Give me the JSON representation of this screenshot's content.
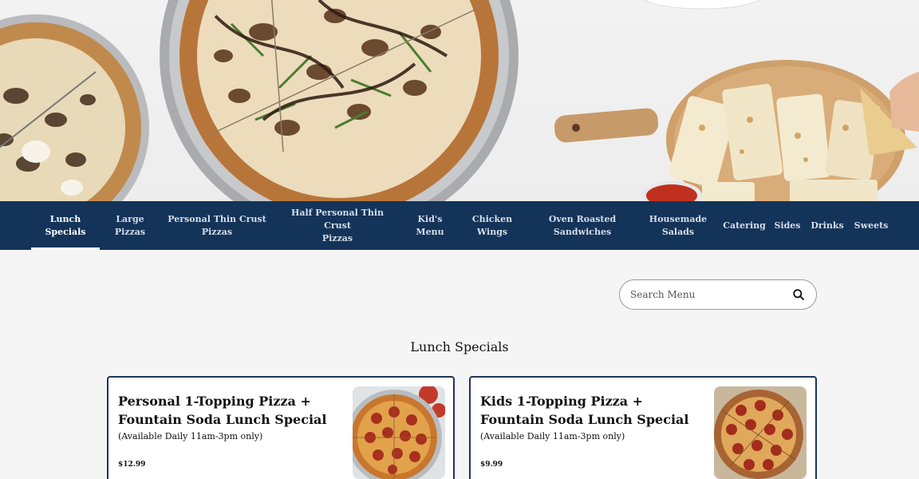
{
  "nav": {
    "items": [
      {
        "line1": "Lunch",
        "line2": "Specials",
        "active": true
      },
      {
        "line1": "Large",
        "line2": "Pizzas"
      },
      {
        "line1": "Personal Thin Crust",
        "line2": "Pizzas"
      },
      {
        "line1": "Half Personal Thin Crust",
        "line2": "Pizzas"
      },
      {
        "line1": "Kid's",
        "line2": "Menu"
      },
      {
        "line1": "Chicken",
        "line2": "Wings"
      },
      {
        "line1": "Oven Roasted",
        "line2": "Sandwiches"
      },
      {
        "line1": "Housemade",
        "line2": "Salads"
      },
      {
        "line1": "Catering",
        "line2": ""
      },
      {
        "line1": "Sides",
        "line2": ""
      },
      {
        "line1": "Drinks",
        "line2": ""
      },
      {
        "line1": "Sweets",
        "line2": ""
      }
    ]
  },
  "search": {
    "placeholder": "Search Menu",
    "icon": "search-icon"
  },
  "section": {
    "title": "Lunch Specials"
  },
  "cards": [
    {
      "title": "Personal 1-Topping Pizza + Fountain Soda Lunch Special",
      "description": "(Available Daily 11am-3pm only)",
      "price": "$12.99",
      "image": "pepperoni-pizza-photo"
    },
    {
      "title": "Kids 1-Topping Pizza + Fountain Soda Lunch Special",
      "description": "(Available Daily 11am-3pm only)",
      "price": "$9.99",
      "image": "pepperoni-pizza-photo"
    }
  ],
  "colors": {
    "nav_bg": "#133359",
    "card_border": "#1d3557",
    "page_bg": "#f5f5f5"
  }
}
